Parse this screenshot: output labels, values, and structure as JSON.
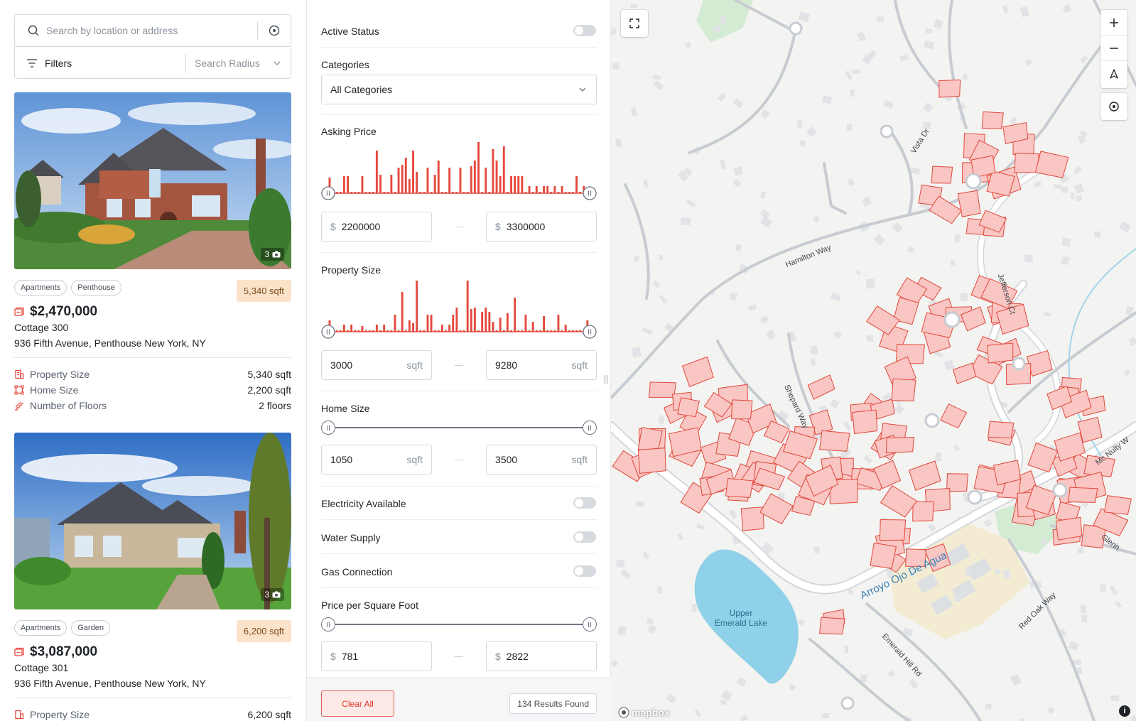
{
  "search": {
    "placeholder": "Search by location or address"
  },
  "toolbar": {
    "filters_label": "Filters",
    "radius_label": "Search Radius"
  },
  "listings": [
    {
      "tags": [
        "Apartments",
        "Penthouse"
      ],
      "size_badge": "5,340 sqft",
      "price": "$2,470,000",
      "name": "Cottage 300",
      "address": "936 Fifth Avenue, Penthouse New York, NY",
      "photo_count": "3",
      "stats": [
        {
          "label": "Property Size",
          "value": "5,340 sqft"
        },
        {
          "label": "Home Size",
          "value": "2,200 sqft"
        },
        {
          "label": "Number of Floors",
          "value": "2 floors"
        }
      ]
    },
    {
      "tags": [
        "Apartments",
        "Garden"
      ],
      "size_badge": "6,200 sqft",
      "price": "$3,087,000",
      "name": "Cottage 301",
      "address": "936 Fifth Avenue, Penthouse New York, NY",
      "photo_count": "3",
      "stats": [
        {
          "label": "Property Size",
          "value": "6,200 sqft"
        }
      ]
    }
  ],
  "filters": {
    "active_status": {
      "label": "Active Status",
      "on": false
    },
    "categories": {
      "label": "Categories",
      "value": "All Categories"
    },
    "asking_price": {
      "label": "Asking Price",
      "currency": "$",
      "min": "2200000",
      "max": "3300000"
    },
    "property_size": {
      "label": "Property Size",
      "unit": "sqft",
      "min": "3000",
      "max": "9280"
    },
    "home_size": {
      "label": "Home Size",
      "unit": "sqft",
      "min": "1050",
      "max": "3500"
    },
    "electricity": {
      "label": "Electricity Available",
      "on": false
    },
    "water": {
      "label": "Water Supply",
      "on": false
    },
    "gas": {
      "label": "Gas Connection",
      "on": false
    },
    "price_per_sqft": {
      "label": "Price per Square Foot",
      "currency": "$",
      "min": "781",
      "max": "2822"
    },
    "clear_label": "Clear All",
    "results_label": "134 Results Found"
  },
  "histograms": {
    "asking_price": [
      22,
      2,
      2,
      2,
      24,
      24,
      2,
      2,
      2,
      24,
      2,
      2,
      2,
      60,
      26,
      2,
      2,
      26,
      2,
      36,
      40,
      50,
      20,
      60,
      30,
      2,
      2,
      36,
      2,
      26,
      46,
      2,
      2,
      36,
      2,
      2,
      36,
      2,
      2,
      38,
      46,
      72,
      2,
      36,
      2,
      62,
      46,
      24,
      66,
      2,
      24,
      24,
      24,
      24,
      2,
      10,
      2,
      10,
      2,
      10,
      10,
      2,
      10,
      2,
      10,
      2,
      2,
      2,
      24,
      2,
      10,
      2
    ],
    "property_size": [
      16,
      2,
      2,
      2,
      10,
      2,
      10,
      2,
      2,
      8,
      2,
      2,
      2,
      10,
      2,
      10,
      2,
      2,
      24,
      2,
      56,
      2,
      16,
      12,
      72,
      2,
      2,
      24,
      24,
      2,
      2,
      10,
      2,
      10,
      24,
      34,
      2,
      2,
      72,
      32,
      34,
      2,
      28,
      34,
      28,
      14,
      2,
      20,
      2,
      26,
      2,
      48,
      2,
      2,
      24,
      2,
      14,
      2,
      2,
      22,
      2,
      2,
      2,
      24,
      2,
      10,
      2,
      2,
      2,
      2,
      2,
      16
    ]
  },
  "map": {
    "streets": [
      "Vista Dr",
      "Hamilton Way",
      "Jefferson Ct",
      "Shepard Way",
      "Emerald Hill Rd",
      "Red Oak Way",
      "Mc Nulty W",
      "Glenn"
    ],
    "lake": "Upper\nEmerald Lake",
    "creek": "Arroyo Ojo De Agua",
    "attribution": "mapbox",
    "parcel_color": "#f9c6c3",
    "parcel_stroke": "#e0483c"
  },
  "colors": {
    "accent": "#e5493d",
    "badge_bg": "#fbe3c9"
  }
}
